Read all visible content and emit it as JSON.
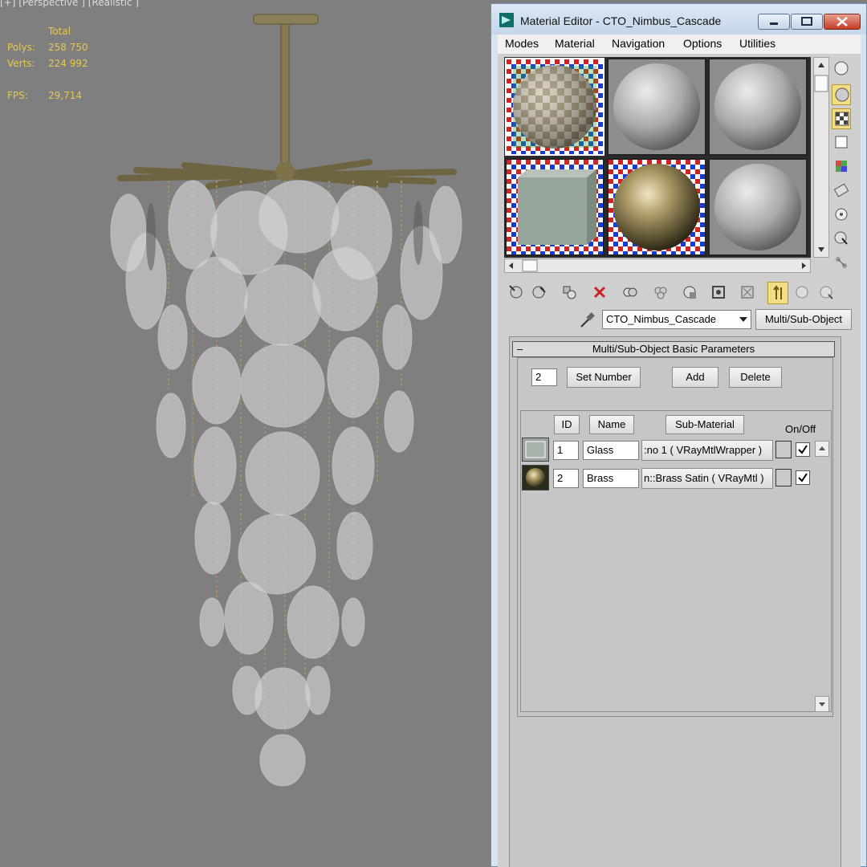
{
  "viewport": {
    "label": "[+] [Perspective ] [Realistic ]",
    "stats": {
      "header": "Total",
      "polys_label": "Polys:",
      "polys_value": "258 750",
      "verts_label": "Verts:",
      "verts_value": "224 992",
      "fps_label": "FPS:",
      "fps_value": "29,714"
    }
  },
  "window": {
    "title": "Material Editor - CTO_Nimbus_Cascade"
  },
  "menu": [
    "Modes",
    "Material",
    "Navigation",
    "Options",
    "Utilities"
  ],
  "material": {
    "name": "CTO_Nimbus_Cascade",
    "type_button": "Multi/Sub-Object"
  },
  "rollout": {
    "title": "Multi/Sub-Object Basic Parameters",
    "count": "2",
    "set_number": "Set Number",
    "add": "Add",
    "delete": "Delete",
    "columns": {
      "id": "ID",
      "name": "Name",
      "sub_material": "Sub-Material",
      "on_off": "On/Off"
    },
    "rows": [
      {
        "id": "1",
        "name": "Glass",
        "sub_material": ":no 1  ( VRayMtlWrapper )",
        "on": true
      },
      {
        "id": "2",
        "name": "Brass",
        "sub_material": "n::Brass Satin  ( VRayMtl )",
        "on": true
      }
    ]
  },
  "colors": {
    "viewport_bg": "#7f7f7f",
    "stats_text": "#e8c84a",
    "window_frame": "#d8e3f0",
    "panel_bg": "#cfcfcf",
    "active_tool": "#f3dc86"
  }
}
